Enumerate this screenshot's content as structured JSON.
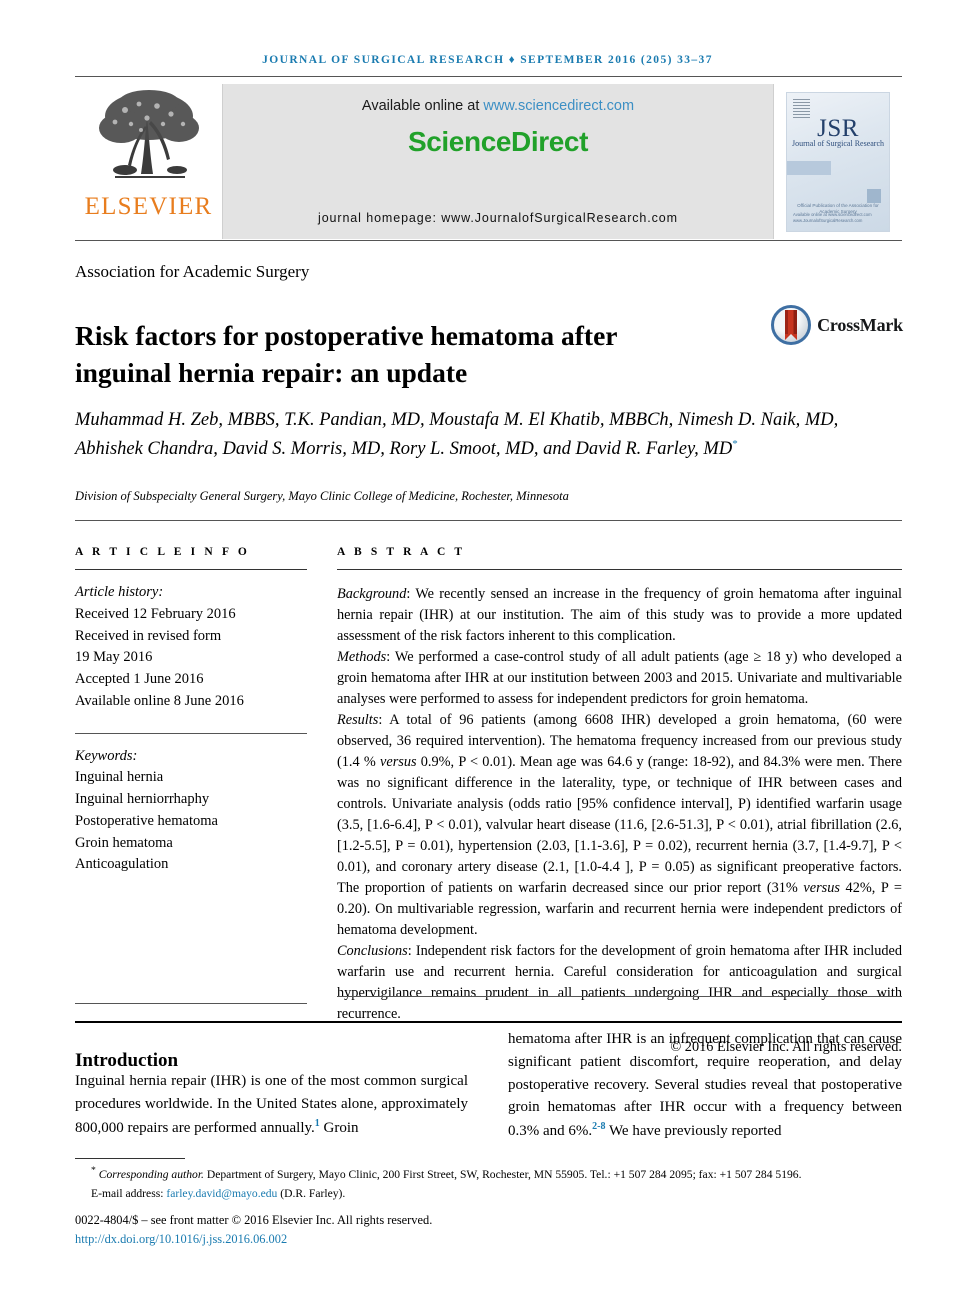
{
  "running_head": "JOURNAL OF SURGICAL RESEARCH ♦ SEPTEMBER 2016 (205) 33–37",
  "masthead": {
    "publisher_name": "ELSEVIER",
    "available_prefix": "Available online at ",
    "available_link": "www.sciencedirect.com",
    "brand": "ScienceDirect",
    "homepage": "journal homepage: www.JournalofSurgicalResearch.com",
    "cover": {
      "title": "JSR",
      "subtitle": "Journal of Surgical Research",
      "note": "Official Publication of the\nAssociation for Academic Surgery",
      "foot": "Available online at www.sciencedirect.com\nwww.JournalofSurgicalResearch.com"
    }
  },
  "society": "Association for Academic Surgery",
  "title": "Risk factors for postoperative hematoma after inguinal hernia repair: an update",
  "crossmark_label": "CrossMark",
  "authors": "Muhammad H. Zeb, MBBS, T.K. Pandian, MD, Moustafa M. El Khatib, MBBCh, Nimesh D. Naik, MD, Abhishek Chandra, David S. Morris, MD, Rory L. Smoot, MD, and David R. Farley, MD",
  "author_marker": "*",
  "affiliation": "Division of Subspecialty General Surgery, Mayo Clinic College of Medicine, Rochester, Minnesota",
  "article_info": {
    "heading": "A R T I C L E   I N F O",
    "history_label": "Article history:",
    "history": [
      "Received 12 February 2016",
      "Received in revised form",
      "19 May 2016",
      "Accepted 1 June 2016",
      "Available online 8 June 2016"
    ],
    "keywords_label": "Keywords:",
    "keywords": [
      "Inguinal hernia",
      "Inguinal herniorrhaphy",
      "Postoperative hematoma",
      "Groin hematoma",
      "Anticoagulation"
    ]
  },
  "abstract": {
    "heading": "A B S T R A C T",
    "background_label": "Background",
    "background": ": We recently sensed an increase in the frequency of groin hematoma after inguinal hernia repair (IHR) at our institution. The aim of this study was to provide a more updated assessment of the risk factors inherent to this complication.",
    "methods_label": "Methods",
    "methods": ": We performed a case-control study of all adult patients (age ≥ 18 y) who developed a groin hematoma after IHR at our institution between 2003 and 2015. Univariate and multivariable analyses were performed to assess for independent predictors for groin hematoma.",
    "results_label": "Results",
    "results_a": ": A total of 96 patients (among 6608 IHR) developed a groin hematoma, (60 were observed, 36 required intervention). The hematoma frequency increased from our previous study (1.4 % ",
    "results_versus_1": "versus",
    "results_b": " 0.9%, P < 0.01). Mean age was 64.6 y (range: 18-92), and 84.3% were men. There was no significant difference in the laterality, type, or technique of IHR between cases and controls. Univariate analysis (odds ratio [95% confidence interval], P) identified warfarin usage (3.5, [1.6-6.4], P < 0.01), valvular heart disease (11.6, [2.6-51.3], P < 0.01), atrial fibrillation (2.6, [1.2-5.5], P = 0.01), hypertension (2.03, [1.1-3.6], P = 0.02), recurrent hernia (3.7, [1.4-9.7], P < 0.01), and coronary artery disease (2.1, [1.0-4.4 ], P = 0.05) as significant preoperative factors. The proportion of patients on warfarin decreased since our prior report (31% ",
    "results_versus_2": "versus",
    "results_c": " 42%, P = 0.20). On multivariable regression, warfarin and recurrent hernia were independent predictors of hematoma development.",
    "conclusions_label": "Conclusions",
    "conclusions": ": Independent risk factors for the development of groin hematoma after IHR included warfarin use and recurrent hernia. Careful consideration for anticoagulation and surgical hypervigilance remains prudent in all patients undergoing IHR and especially those with recurrence.",
    "copyright": "© 2016 Elsevier Inc. All rights reserved."
  },
  "introduction": {
    "heading": "Introduction",
    "left_a": "Inguinal hernia repair (IHR) is one of the most common surgical procedures worldwide. In the United States alone, approximately 800,000 repairs are performed annually.",
    "left_ref": "1",
    "left_b": " Groin",
    "right_a": "hematoma after IHR is an infrequent complication that can cause significant patient discomfort, require reoperation, and delay postoperative recovery. Several studies reveal that postoperative groin hematomas after IHR occur with a frequency between 0.3% and 6%.",
    "right_ref": "2-8",
    "right_b": " We have previously reported"
  },
  "footer": {
    "corresponding_marker": "*",
    "corresponding_label": "Corresponding author.",
    "corresponding_text": " Department of Surgery, Mayo Clinic, 200 First Street, SW, Rochester, MN 55905. Tel.: +1 507 284 2095; fax: +1 507 284 5196.",
    "email_label": "E-mail address: ",
    "email": "farley.david@mayo.edu",
    "email_suffix": " (D.R. Farley).",
    "front_matter": "0022-4804/$ – see front matter © 2016 Elsevier Inc. All rights reserved.",
    "doi": "http://dx.doi.org/10.1016/j.jss.2016.06.002"
  },
  "colors": {
    "link_blue": "#1a7bb0",
    "sciencedirect_green": "#21a12a",
    "elsevier_orange": "#e87d1e",
    "masthead_grey": "#e3e3e3",
    "crossmark_red": "#c6341f",
    "crossmark_ring": "#3e6fa3"
  }
}
